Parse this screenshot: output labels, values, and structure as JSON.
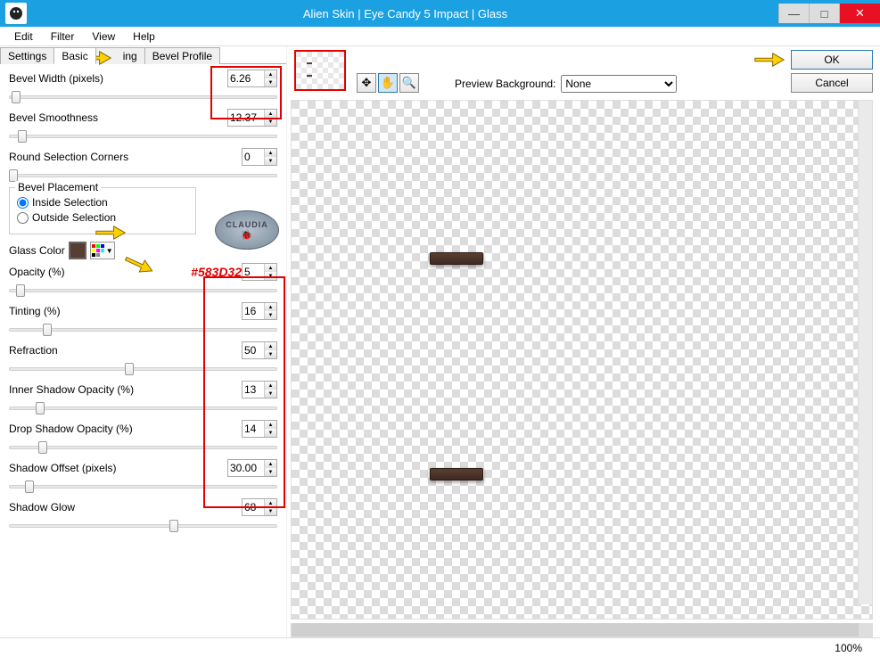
{
  "window": {
    "title": "Alien Skin | Eye Candy 5 Impact | Glass",
    "minimize": "—",
    "maximize": "□",
    "close": "✕"
  },
  "menu": {
    "edit": "Edit",
    "filter": "Filter",
    "view": "View",
    "help": "Help"
  },
  "tabs": {
    "settings": "Settings",
    "basic": "Basic",
    "lighting": "ing",
    "bevel_profile": "Bevel Profile"
  },
  "left": {
    "bevel_width_label": "Bevel Width (pixels)",
    "bevel_width_value": "6.26",
    "bevel_smoothness_label": "Bevel Smoothness",
    "bevel_smoothness_value": "12.37",
    "round_corners_label": "Round Selection Corners",
    "round_corners_value": "0",
    "bevel_placement_legend": "Bevel Placement",
    "inside_label": "Inside Selection",
    "outside_label": "Outside Selection",
    "glass_color_label": "Glass Color",
    "glass_color_hex": "#583D32",
    "glass_color_note": "#583D32",
    "opacity_label": "Opacity (%)",
    "opacity_value": "5",
    "tinting_label": "Tinting (%)",
    "tinting_value": "16",
    "refraction_label": "Refraction",
    "refraction_value": "50",
    "inner_shadow_label": "Inner Shadow Opacity (%)",
    "inner_shadow_value": "13",
    "drop_shadow_label": "Drop Shadow Opacity (%)",
    "drop_shadow_value": "14",
    "shadow_offset_label": "Shadow Offset (pixels)",
    "shadow_offset_value": "30.00",
    "shadow_glow_label": "Shadow Glow",
    "shadow_glow_value": "68"
  },
  "right": {
    "preview_bg_label": "Preview Background:",
    "preview_bg_value": "None",
    "ok": "OK",
    "cancel": "Cancel"
  },
  "status": {
    "zoom": "100%"
  },
  "claudia": {
    "text": "CLAUDIA"
  }
}
